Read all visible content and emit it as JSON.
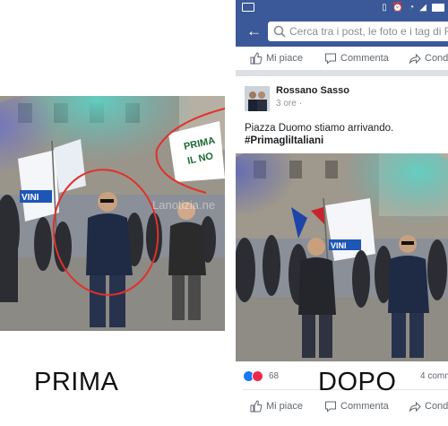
{
  "captions": {
    "before": "PRIMA",
    "after": "DOPO"
  },
  "photo_before": {
    "banner_text": "PRIMA\nIL NO",
    "flag_text": "VINI",
    "watermark": "Lanotizia.ne"
  },
  "facebook": {
    "search": {
      "placeholder": "Cerca tra i post, le foto e i tag di R"
    },
    "top_actions": {
      "like": "Mi piace",
      "comment": "Commenta",
      "share": "Condi"
    },
    "post": {
      "author": "Rossano Sasso",
      "time": "3 ore",
      "text": "Piazza Duomo stiamo arrivando.",
      "hashtag": "#PrimagliItaliani"
    },
    "reactions": {
      "count": "68",
      "comments": "4 comm"
    },
    "bottom_actions": {
      "like": "Mi piace",
      "comment": "Commenta",
      "share": "Condi"
    }
  },
  "colors": {
    "facebook_blue": "#3b5998",
    "annotation_red": "#e0312a",
    "smoke": "#5fb6b8"
  }
}
